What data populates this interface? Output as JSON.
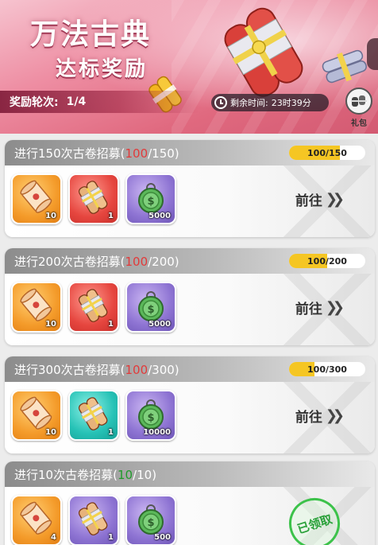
{
  "banner": {
    "title_main": "万法古典",
    "title_sub": "达标奖励",
    "round_label": "奖励轮次:",
    "round_value": "1/4",
    "timer_label": "剩余时间:",
    "timer_value": "23时39分",
    "gift_label": "礼包"
  },
  "tasks": [
    {
      "title_prefix": "进行150次古卷招募(",
      "current": "100",
      "title_suffix": "/150)",
      "progress_text": "100/150",
      "progress_fraction": 0.667,
      "items": [
        {
          "icon": "scroll-icon",
          "color": "orange",
          "qty": "10"
        },
        {
          "icon": "scroll-bundle-icon",
          "color": "red",
          "qty": "1"
        },
        {
          "icon": "coin-pouch-icon",
          "color": "purple",
          "qty": "5000"
        }
      ],
      "action": "前往",
      "claimed": false
    },
    {
      "title_prefix": "进行200次古卷招募(",
      "current": "100",
      "title_suffix": "/200)",
      "progress_text": "100/200",
      "progress_fraction": 0.5,
      "items": [
        {
          "icon": "scroll-icon",
          "color": "orange",
          "qty": "10"
        },
        {
          "icon": "scroll-bundle-icon",
          "color": "red",
          "qty": "1"
        },
        {
          "icon": "coin-pouch-icon",
          "color": "purple",
          "qty": "5000"
        }
      ],
      "action": "前往",
      "claimed": false
    },
    {
      "title_prefix": "进行300次古卷招募(",
      "current": "100",
      "title_suffix": "/300)",
      "progress_text": "100/300",
      "progress_fraction": 0.333,
      "items": [
        {
          "icon": "scroll-icon",
          "color": "orange",
          "qty": "10"
        },
        {
          "icon": "scroll-bundle-icon",
          "color": "teal",
          "qty": "1"
        },
        {
          "icon": "coin-pouch-icon",
          "color": "purple",
          "qty": "10000"
        }
      ],
      "action": "前往",
      "claimed": false
    },
    {
      "title_prefix": "进行10次古卷招募(",
      "current": "10",
      "title_suffix": "/10)",
      "progress_text": "",
      "progress_fraction": 1,
      "items": [
        {
          "icon": "scroll-icon",
          "color": "orange",
          "qty": "4"
        },
        {
          "icon": "scroll-bundle-icon",
          "color": "purple",
          "qty": "1"
        },
        {
          "icon": "coin-pouch-icon",
          "color": "purple",
          "qty": "500"
        }
      ],
      "action": "已领取",
      "claimed": true
    }
  ],
  "colors": {
    "progress_fill": "#f5c623",
    "current_incomplete": "#e23a3a",
    "current_complete": "#1f9b2a",
    "claimed_stamp": "#3cc24a"
  }
}
